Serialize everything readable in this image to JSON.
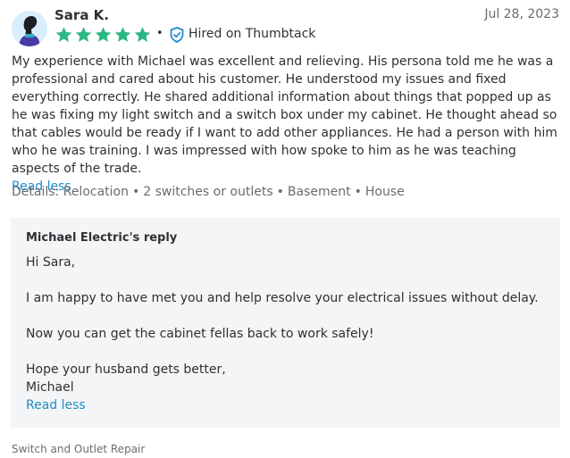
{
  "review": {
    "author": "Sara K.",
    "date": "Jul 28, 2023",
    "rating": 5,
    "separator": "•",
    "hired_label": "Hired on Thumbtack",
    "text": "My experience with Michael was excellent and relieving. His persona told me he was a professional and cared about his customer. He understood my issues and fixed everything correctly. He shared additional information about things that popped up as he was fixing my light switch and a switch box under my cabinet. He thought ahead so that cables would be ready if I want to add other appliances. He had a person with him who he was training. I was impressed with how spoke to him as he was teaching aspects of the trade.",
    "read_less": "Read less",
    "details_label": "Details:",
    "details": [
      "Relocation",
      "2 switches or outlets",
      "Basement",
      "House"
    ]
  },
  "reply": {
    "title": "Michael Electric's reply",
    "greeting": "Hi Sara,",
    "para1": "I am happy to have met you and help resolve your electrical issues without delay.",
    "para2": "Now you can get the cabinet fellas back to work safely!",
    "para3": "Hope your husband gets better,",
    "signature": "Michael",
    "read_less": "Read less"
  },
  "category": "Switch and Outlet Repair",
  "colors": {
    "star": "#2db783",
    "link": "#1f8cc9",
    "hired_icon": "#1f8cc9",
    "reply_bg": "#f4f5f6",
    "avatar_bg": "#d9eefc"
  },
  "icons": {
    "avatar": "person-silhouette",
    "star": "star-icon",
    "hired": "shield-check-icon"
  }
}
